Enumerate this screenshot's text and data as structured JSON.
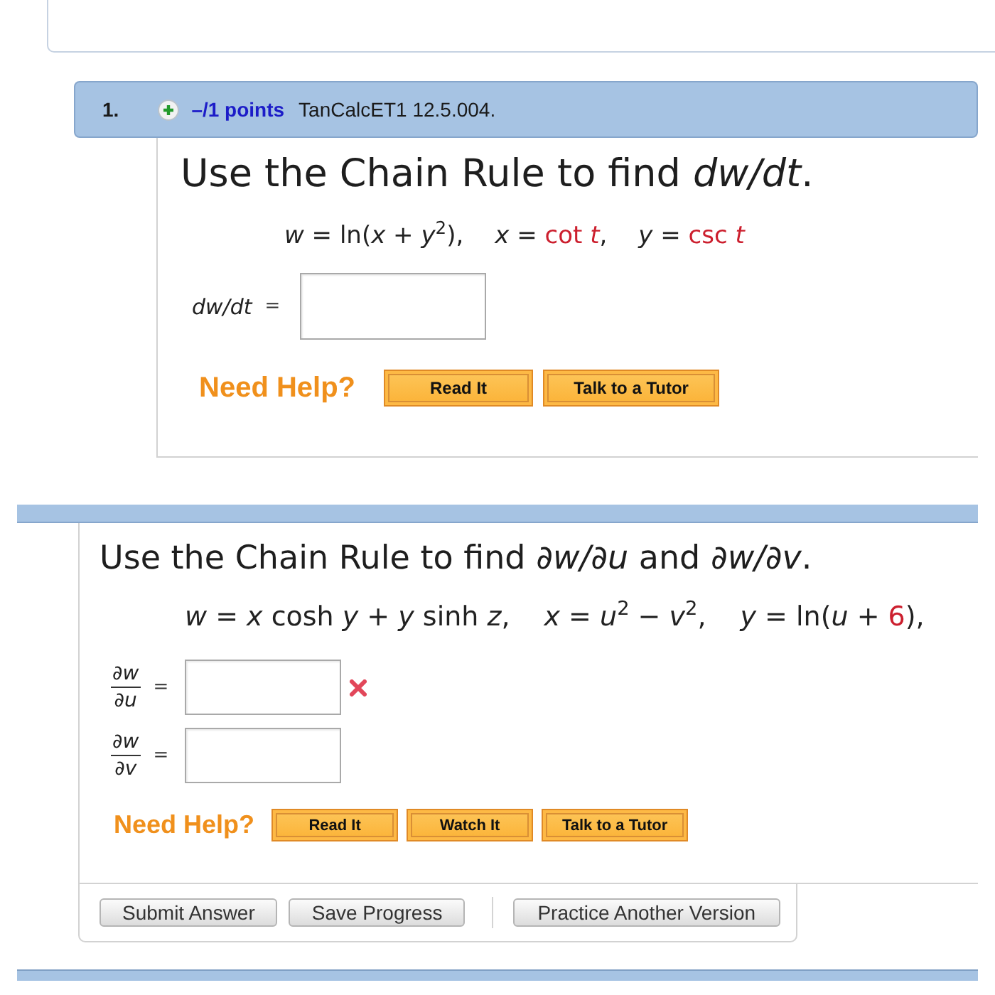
{
  "question_1": {
    "number": "1.",
    "points": "–/1 points",
    "source": "TanCalcET1 12.5.004.",
    "prompt": "Use the Chain Rule to find *dw/dt*.",
    "formula": [
      {
        "segments": [
          {
            "text": "*w* = ln(*x* + *y*$^{2}$),",
            "highlighted": false
          }
        ]
      },
      {
        "segments": [
          {
            "text": "*x* = ",
            "highlighted": false
          },
          {
            "text": "cot *t*",
            "highlighted": true
          },
          {
            "text": ",",
            "highlighted": false
          }
        ]
      },
      {
        "segments": [
          {
            "text": "*y* = ",
            "highlighted": false
          },
          {
            "text": "csc *t*",
            "highlighted": true
          }
        ]
      }
    ],
    "answers": [
      {
        "kind": "inline",
        "label": "dw/dt",
        "relation": "=",
        "marked_incorrect": false
      }
    ],
    "help": {
      "label": "Need Help?",
      "buttons": [
        "Read It",
        "Talk to a Tutor"
      ]
    }
  },
  "question_2": {
    "prompt": "Use the Chain Rule to find *∂w/∂u* and *∂w/∂v*.",
    "formula": [
      {
        "segments": [
          {
            "text": "*w* = *x* cosh *y* + *y* sinh *z*,",
            "highlighted": false
          }
        ]
      },
      {
        "segments": [
          {
            "text": "*x* = *u*$^{2}$ − *v*$^{2}$,",
            "highlighted": false
          }
        ]
      },
      {
        "segments": [
          {
            "text": "*y* = ln(*u* + ",
            "highlighted": false
          },
          {
            "text": "6",
            "highlighted": true
          },
          {
            "text": "),",
            "highlighted": false
          }
        ]
      }
    ],
    "answers": [
      {
        "kind": "fraction",
        "numerator": "∂*w*",
        "denominator": "∂*u*",
        "relation": "=",
        "marked_incorrect": true
      },
      {
        "kind": "fraction",
        "numerator": "∂*w*",
        "denominator": "∂*v*",
        "relation": "=",
        "marked_incorrect": false
      }
    ],
    "help": {
      "label": "Need Help?",
      "buttons": [
        "Read It",
        "Watch It",
        "Talk to a Tutor"
      ]
    },
    "footer": {
      "actions": [
        "Submit Answer",
        "Save Progress"
      ],
      "practice": "Practice Another Version"
    }
  }
}
